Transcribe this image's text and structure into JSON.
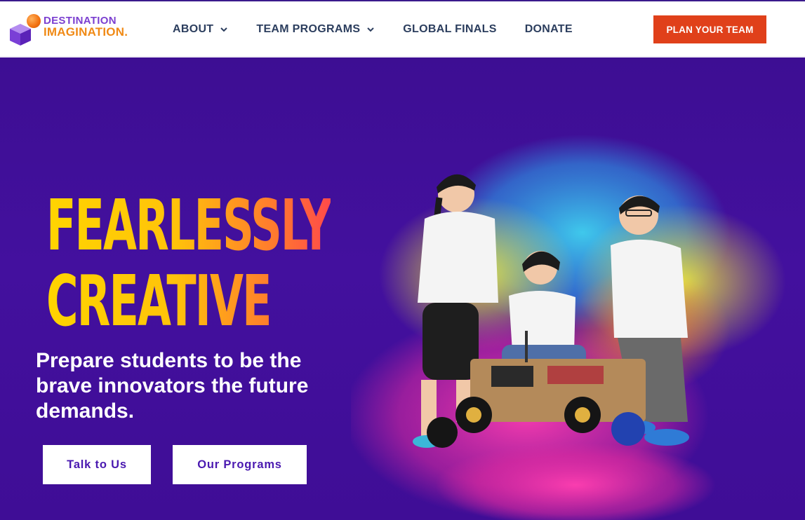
{
  "brand": {
    "line1": "DESTINATION",
    "line2": "IMAGINATION.",
    "colors": {
      "purple": "#7b3fd0",
      "orange": "#f08a16"
    }
  },
  "nav": {
    "items": [
      {
        "label": "ABOUT",
        "has_dropdown": true
      },
      {
        "label": "TEAM PROGRAMS",
        "has_dropdown": true
      },
      {
        "label": "GLOBAL FINALS",
        "has_dropdown": false
      },
      {
        "label": "DONATE",
        "has_dropdown": false
      }
    ],
    "cta_label": "PLAN YOUR TEAM",
    "cta_color": "#e0401a"
  },
  "hero": {
    "headline_line1": "FEARLESSLY",
    "headline_line2": "CREATIVE",
    "subheading": "Prepare students to be the brave innovators the future demands.",
    "buttons": {
      "talk": "Talk to Us",
      "programs": "Our Programs"
    },
    "background_color": "#3f0d96",
    "illustration": "students-building-robot-car-with-color-powder-burst"
  }
}
